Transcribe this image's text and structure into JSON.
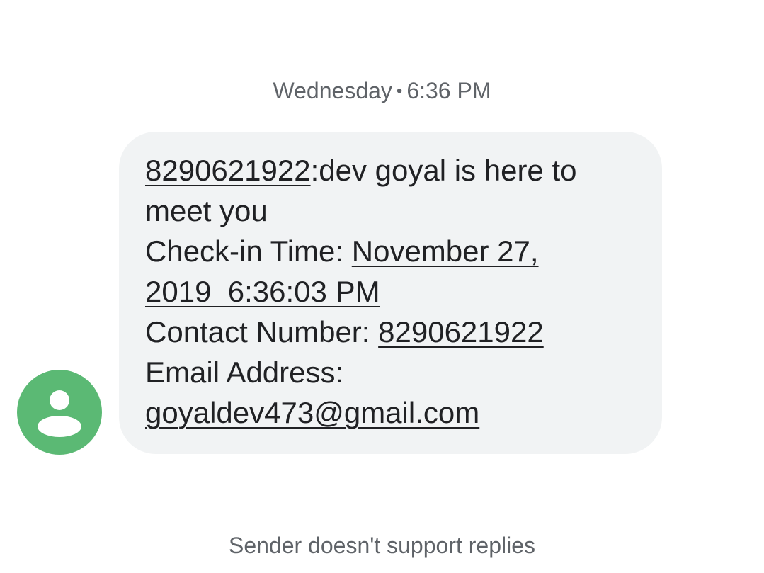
{
  "header": {
    "day": "Wednesday",
    "separator": "•",
    "time": "6:36 PM"
  },
  "sender": {
    "avatar_icon": "person-icon",
    "avatar_color": "#5bb974"
  },
  "message": {
    "phone_link": "8290621922",
    "line1_rest": ":dev goyal is here to",
    "line2": "meet you",
    "checkin_label": "Check-in Time: ",
    "checkin_date_part1": "November 27,",
    "checkin_date_part2": "2019  6:36:03 PM",
    "contact_label": "Contact Number: ",
    "contact_number": "8290621922",
    "email_label": "Email Address:",
    "email": "goyaldev473@gmail.com",
    "bubble_color": "#f1f3f4"
  },
  "footer": {
    "notice": "Sender doesn't support replies"
  }
}
